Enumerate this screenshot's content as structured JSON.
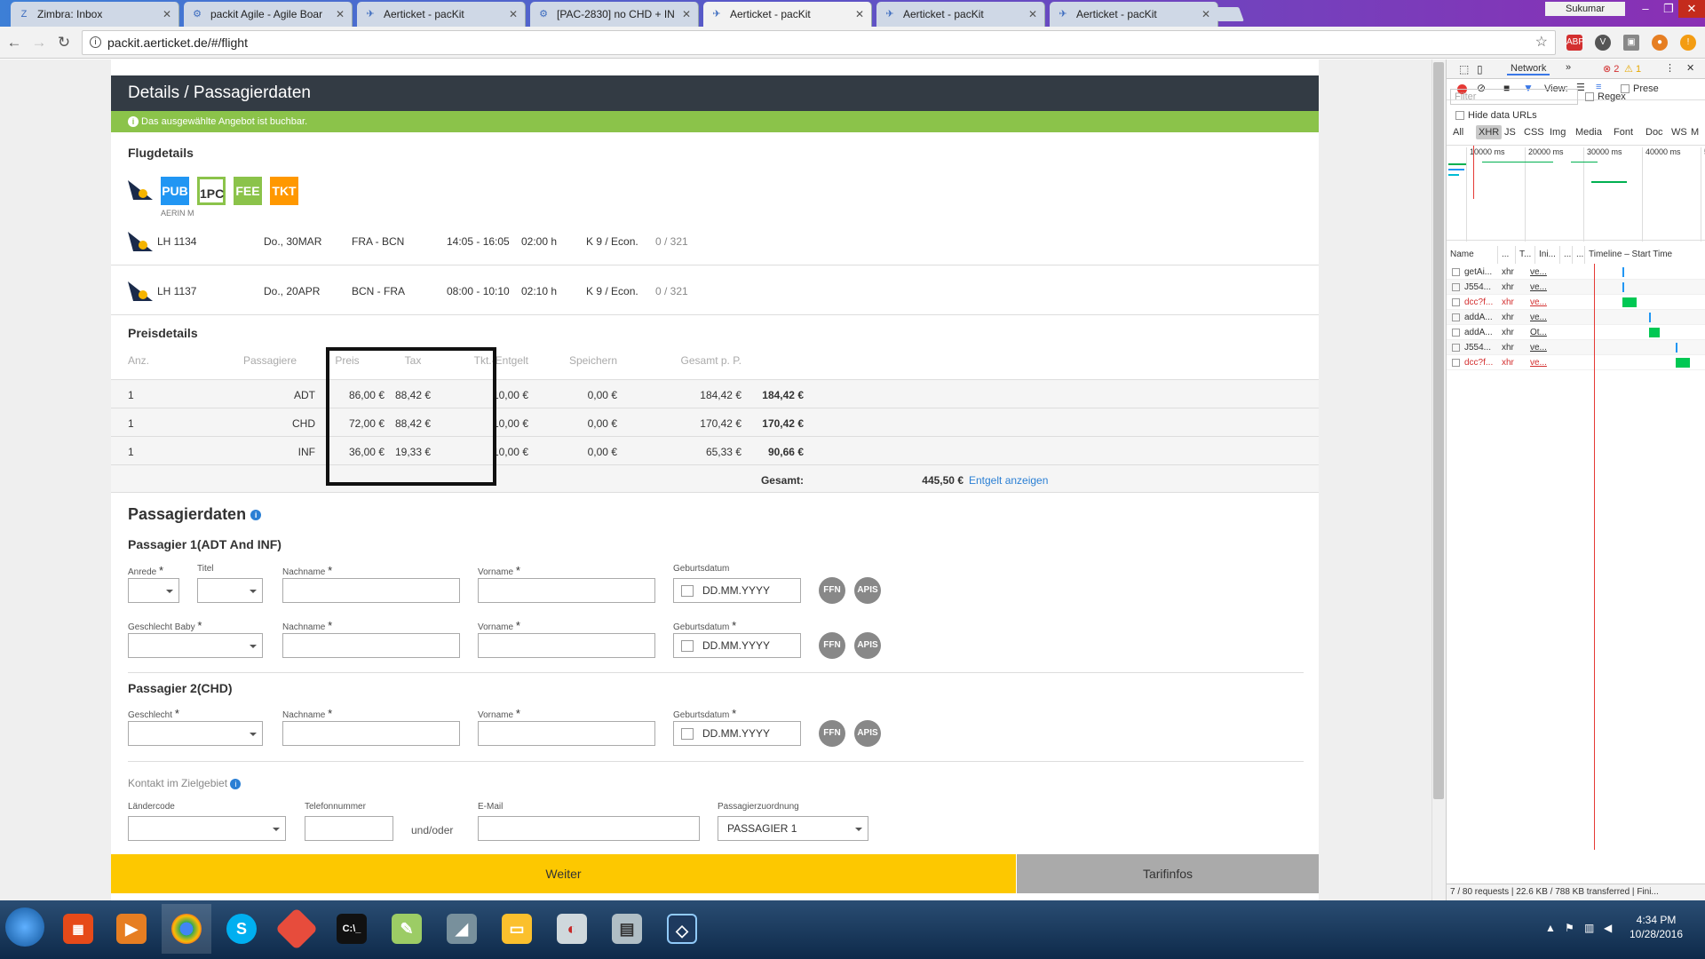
{
  "browser": {
    "tabs": [
      {
        "title": "Zimbra: Inbox",
        "icon": "zimbra-icon"
      },
      {
        "title": "packit Agile - Agile Boar",
        "icon": "jira-icon"
      },
      {
        "title": "Aerticket - pacKit",
        "icon": "packit-icon"
      },
      {
        "title": "[PAC-2830] no CHD + IN",
        "icon": "jira-icon"
      },
      {
        "title": "Aerticket - pacKit",
        "icon": "packit-icon",
        "active": true
      },
      {
        "title": "Aerticket - pacKit",
        "icon": "packit-icon"
      },
      {
        "title": "Aerticket - pacKit",
        "icon": "packit-icon"
      }
    ],
    "user": "Sukumar",
    "url": "packit.aerticket.de/#/flight"
  },
  "page": {
    "header_title": "Details / Passagierdaten",
    "notice": "Das ausgewählte Angebot ist buchbar.",
    "flight_section_title": "Flugdetails",
    "badges": [
      {
        "label": "PUB",
        "color": "#2196f3"
      },
      {
        "label": "1PC",
        "color": "#8bc34a"
      },
      {
        "label": "FEE",
        "color": "#8bc34a"
      },
      {
        "label": "TKT",
        "color": "#ff9800"
      }
    ],
    "airline_sub": "AERIN M",
    "flights": [
      {
        "number": "LH 1134",
        "date": "Do., 30MAR",
        "route": "FRA - BCN",
        "time": "14:05 - 16:05",
        "duration": "02:00 h",
        "class": "K 9 / Econ.",
        "seats": "0 / 321"
      },
      {
        "number": "LH 1137",
        "date": "Do., 20APR",
        "route": "BCN - FRA",
        "time": "08:00 - 10:10",
        "duration": "02:10 h",
        "class": "K 9 / Econ.",
        "seats": "0 / 321"
      }
    ],
    "price_section_title": "Preisdetails",
    "price_headers": {
      "anz": "Anz.",
      "pax": "Passagiere",
      "preis": "Preis",
      "tax": "Tax",
      "tkt": "Tkt.-Entgelt",
      "speichern": "Speichern",
      "gesamt": "Gesamt p. P."
    },
    "price_rows": [
      {
        "anz": "1",
        "pax": "ADT",
        "preis": "86,00 €",
        "tax": "88,42 €",
        "tkt": "10,00 €",
        "speichern": "0,00 €",
        "gesamt_pp": "184,42 €",
        "total": "184,42 €"
      },
      {
        "anz": "1",
        "pax": "CHD",
        "preis": "72,00 €",
        "tax": "88,42 €",
        "tkt": "10,00 €",
        "speichern": "0,00 €",
        "gesamt_pp": "170,42 €",
        "total": "170,42 €"
      },
      {
        "anz": "1",
        "pax": "INF",
        "preis": "36,00 €",
        "tax": "19,33 €",
        "tkt": "10,00 €",
        "speichern": "0,00 €",
        "gesamt_pp": "65,33 €",
        "total": "90,66 €"
      }
    ],
    "gesamt_label": "Gesamt:",
    "gesamt_value": "445,50 €",
    "entgelt_link": "Entgelt anzeigen",
    "pax_section_title": "Passagierdaten",
    "pax1_title": "Passagier 1(ADT And INF)",
    "pax2_title": "Passagier 2(CHD)",
    "labels": {
      "anrede": "Anrede",
      "titel": "Titel",
      "nachname": "Nachname",
      "vorname": "Vorname",
      "geburtsdatum": "Geburtsdatum",
      "geschlecht_baby": "Geschlecht Baby",
      "geschlecht": "Geschlecht",
      "req": "*"
    },
    "date_placeholder": "DD.MM.YYYY",
    "ffn": "FFN",
    "apis": "APIS",
    "kontakt_title": "Kontakt im Zielgebiet",
    "kontakt_labels": {
      "laendercode": "Ländercode",
      "telefon": "Telefonnummer",
      "email": "E-Mail",
      "zuordnung": "Passagierzuordnung"
    },
    "und_oder": "und/oder",
    "zuordnung_value": "PASSAGIER 1",
    "weiter": "Weiter",
    "tarifinfos": "Tarifinfos"
  },
  "devtools": {
    "tab": "Network",
    "errors": "2",
    "warnings": "1",
    "view_label": "View:",
    "preserve": "Prese",
    "filter_placeholder": "Filter",
    "regex": "Regex",
    "hide_data_urls": "Hide data URLs",
    "types": [
      "All",
      "XHR",
      "JS",
      "CSS",
      "Img",
      "Media",
      "Font",
      "Doc",
      "WS",
      "M"
    ],
    "timeline_ticks": [
      "10000 ms",
      "20000 ms",
      "30000 ms",
      "40000 ms",
      "5"
    ],
    "columns": [
      "Name",
      "...",
      "T...",
      "Ini...",
      "...",
      "...",
      "Timeline – Start Time"
    ],
    "requests": [
      {
        "name": "getAi...",
        "type": "xhr",
        "init": "ve...",
        "error": false
      },
      {
        "name": "J554...",
        "type": "xhr",
        "init": "ve...",
        "error": false
      },
      {
        "name": "dcc?f...",
        "type": "xhr",
        "init": "ve...",
        "error": true
      },
      {
        "name": "addA...",
        "type": "xhr",
        "init": "ve...",
        "error": false
      },
      {
        "name": "addA...",
        "type": "xhr",
        "init": "Ot...",
        "error": false
      },
      {
        "name": "J554...",
        "type": "xhr",
        "init": "ve...",
        "error": false
      },
      {
        "name": "dcc?f...",
        "type": "xhr",
        "init": "ve...",
        "error": true
      }
    ],
    "status": "7 / 80 requests  |  22.6 KB / 788 KB transferred  |  Fini..."
  },
  "taskbar": {
    "time": "4:34 PM",
    "date": "10/28/2016"
  }
}
